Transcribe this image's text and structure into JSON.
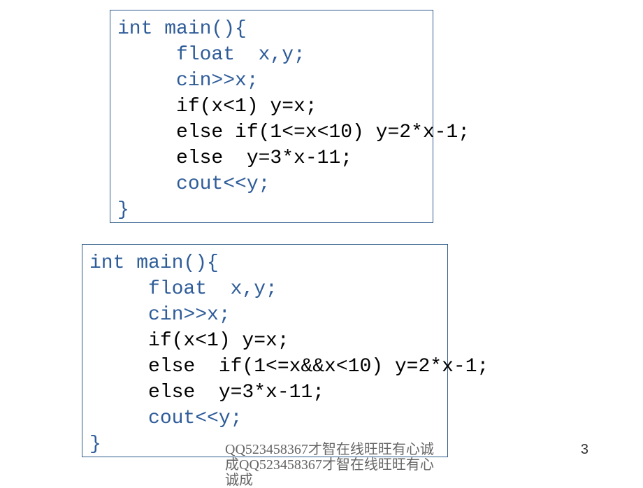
{
  "box1": {
    "l1a": "int main(){",
    "l2a": "     float  x,y;",
    "l3a": "     cin>>x;",
    "l4": "     if(x<1) y=x;",
    "l5": "     else if(1<=x<10) y=2*x-1;",
    "l6": "     else  y=3*x-11;",
    "l7a": "     cout<<y;",
    "l8a": "}"
  },
  "box2": {
    "l1a": "int main(){",
    "l2a": "     float  x,y;",
    "l3a": "     cin>>x;",
    "l4": "     if(x<1) y=x;",
    "l5": "     else  if(1<=x&&x<10) y=2*x-1;",
    "l6": "     else  y=3*x-11;",
    "l7a": "     cout<<y;",
    "l8a": "}"
  },
  "footer": "QQ523458367才智在线旺旺有心诚成QQ523458367才智在线旺旺有心诚成",
  "page": "3"
}
